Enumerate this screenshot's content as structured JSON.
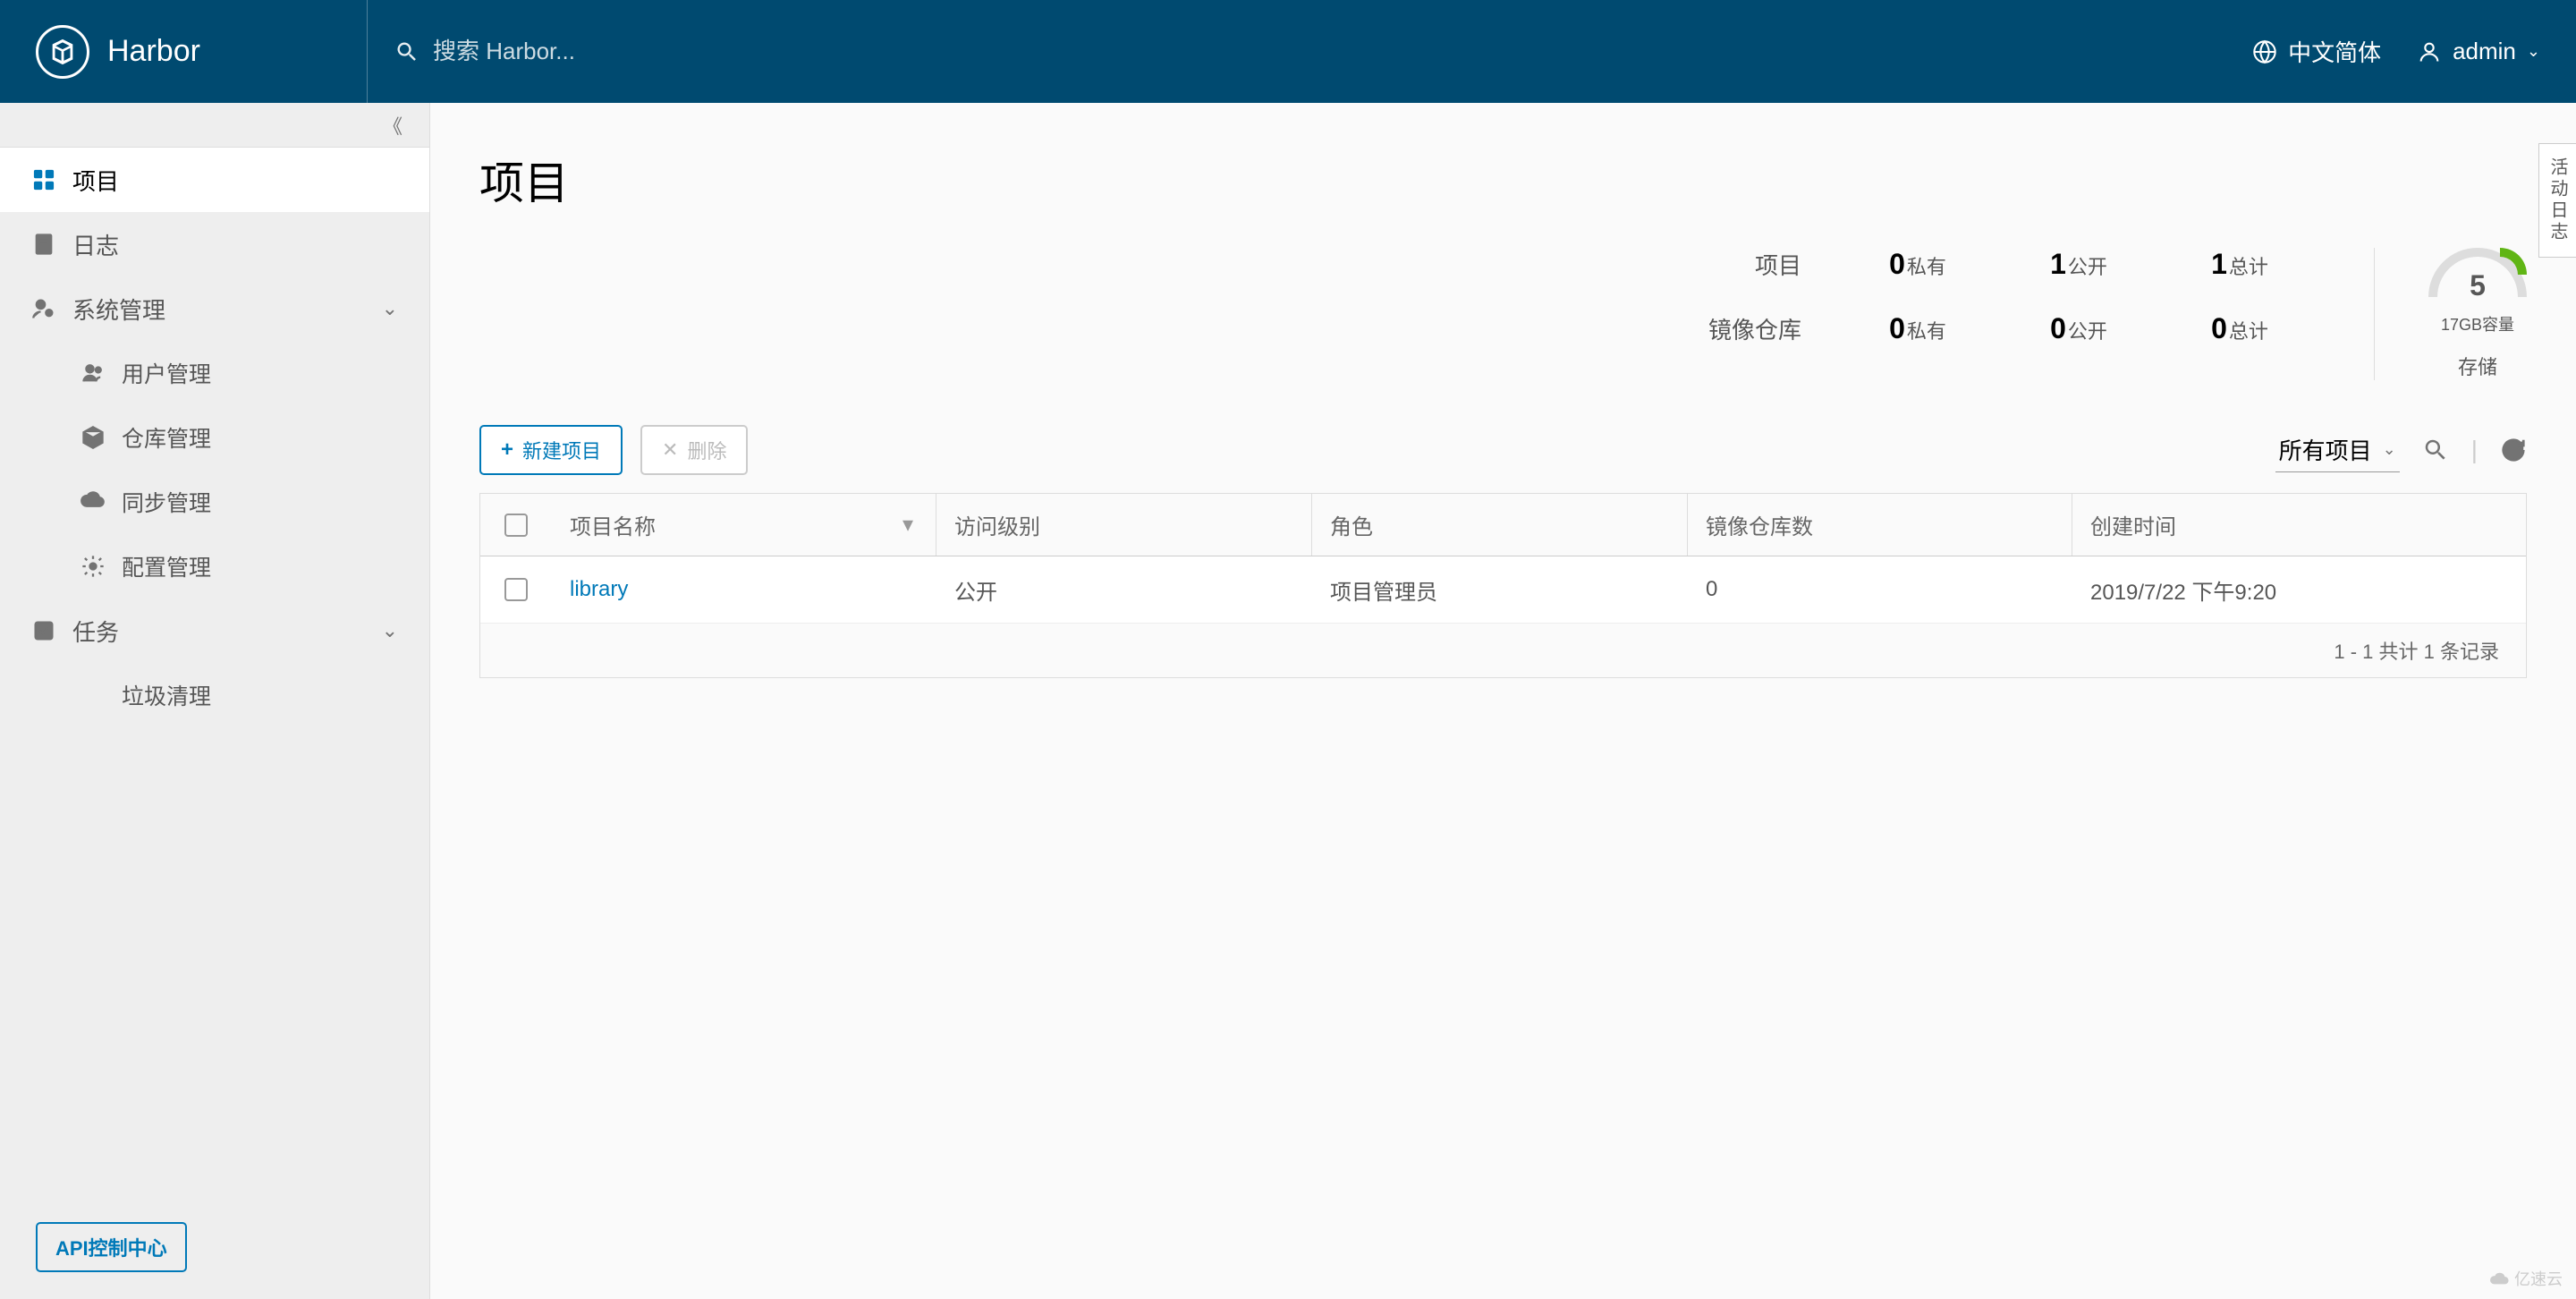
{
  "header": {
    "app_name": "Harbor",
    "search_placeholder": "搜索 Harbor...",
    "language": "中文简体",
    "user": "admin"
  },
  "sidebar": {
    "items": {
      "projects": "项目",
      "logs": "日志",
      "system": "系统管理",
      "users": "用户管理",
      "registries": "仓库管理",
      "replication": "同步管理",
      "config": "配置管理",
      "tasks": "任务",
      "gc": "垃圾清理"
    },
    "api_button": "API控制中心"
  },
  "main": {
    "title": "项目",
    "stats": {
      "row1_label": "项目",
      "row2_label": "镜像仓库",
      "private_label": "私有",
      "public_label": "公开",
      "total_label": "总计",
      "proj_private": "0",
      "proj_public": "1",
      "proj_total": "1",
      "repo_private": "0",
      "repo_public": "0",
      "repo_total": "0",
      "storage_value": "5",
      "storage_capacity": "17GB容量",
      "storage_label": "存储"
    },
    "toolbar": {
      "new_project": "新建项目",
      "delete": "删除",
      "filter_select": "所有项目"
    },
    "table": {
      "headers": {
        "name": "项目名称",
        "access": "访问级别",
        "role": "角色",
        "repos": "镜像仓库数",
        "created": "创建时间"
      },
      "rows": [
        {
          "name": "library",
          "access": "公开",
          "role": "项目管理员",
          "repos": "0",
          "created": "2019/7/22 下午9:20"
        }
      ],
      "footer": "1 - 1 共计 1 条记录"
    },
    "side_tab": "活动日志",
    "watermark": "亿速云"
  }
}
